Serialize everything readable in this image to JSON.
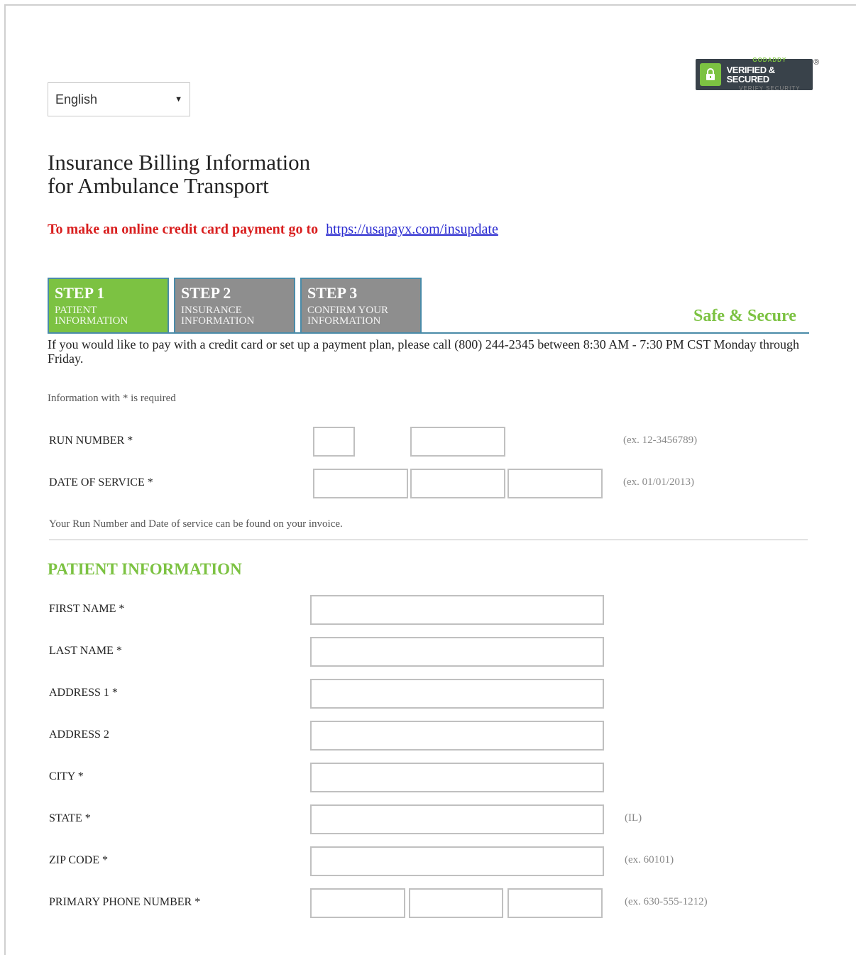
{
  "language_select": {
    "selected": "English"
  },
  "badge": {
    "line1": "GODADDY",
    "line2": "VERIFIED & SECURED",
    "line3": "VERIFY SECURITY",
    "registered": "®"
  },
  "title": {
    "line1": "Insurance Billing Information",
    "line2": "for Ambulance Transport"
  },
  "payment": {
    "text": "To make an online credit card payment go to",
    "link": "https://usapayx.com/insupdate"
  },
  "steps": [
    {
      "title": "STEP 1",
      "subtitle": "PATIENT INFORMATION",
      "active": true
    },
    {
      "title": "STEP 2",
      "subtitle": "INSURANCE INFORMATION",
      "active": false
    },
    {
      "title": "STEP 3",
      "subtitle": "CONFIRM YOUR INFORMATION",
      "active": false
    }
  ],
  "safe_secure": "Safe & Secure",
  "notice": "If you would like to pay with a credit card or set up a payment plan, please call (800) 244-2345 between 8:30 AM - 7:30 PM CST Monday through Friday.",
  "required_note": "Information with * is required",
  "run_number": {
    "label": "RUN NUMBER *",
    "hint": "(ex. 12-3456789)"
  },
  "date_of_service": {
    "label": "DATE OF SERVICE *",
    "hint": "(ex. 01/01/2013)"
  },
  "info_note": "Your Run Number and Date of service can be found on your invoice.",
  "patient_section": {
    "title": "PATIENT INFORMATION",
    "first_name": {
      "label": "FIRST NAME *"
    },
    "last_name": {
      "label": "LAST NAME *"
    },
    "address1": {
      "label": "ADDRESS 1 *"
    },
    "address2": {
      "label": "ADDRESS 2"
    },
    "city": {
      "label": "CITY *"
    },
    "state": {
      "label": "STATE *",
      "hint": "(IL)"
    },
    "zip": {
      "label": "ZIP CODE *",
      "hint": "(ex. 60101)"
    },
    "phone": {
      "label": "PRIMARY PHONE NUMBER *",
      "hint": "(ex. 630-555-1212)"
    }
  },
  "colors": {
    "brand_green": "#7cc242",
    "link_blue": "#2a2ad0",
    "alert_red": "#d91f1f",
    "step_inactive": "#8e8e8e",
    "step_border": "#4a8ba8"
  }
}
